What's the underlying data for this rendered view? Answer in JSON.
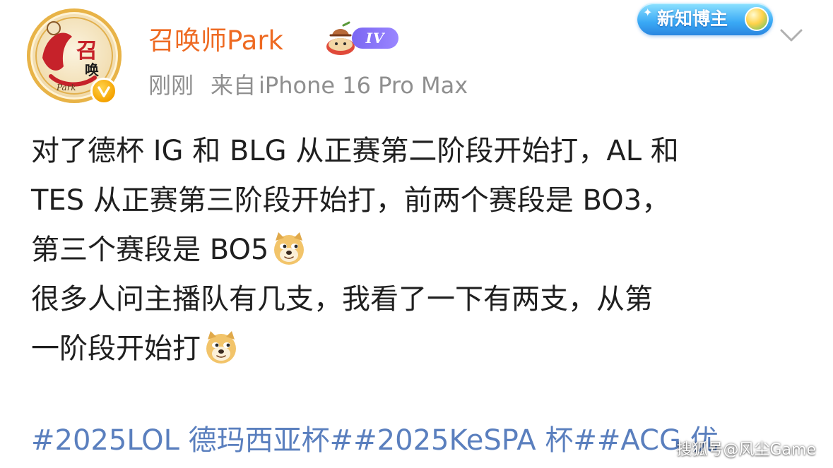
{
  "header": {
    "username": "召唤师Park",
    "level_badge": "IV",
    "hot_badge": "新知博主",
    "meta": {
      "time": "刚刚",
      "source_prefix": "来自",
      "device": "iPhone 16 Pro Max"
    }
  },
  "avatar": {
    "logo_text_1": "召",
    "logo_text_2": "唤",
    "logo_text_3": "Park"
  },
  "post": {
    "lines": [
      "对了德杯 IG 和 BLG 从正赛第二阶段开始打，AL 和",
      "TES 从正赛第三阶段开始打，前两个赛段是 BO3，",
      "第三个赛段是 BO5",
      "很多人问主播队有几支，我看了一下有两支，从第",
      "一阶段开始打"
    ],
    "emojis": [
      "doge-emoji",
      "doge-emoji"
    ]
  },
  "hashtags": "#2025LOL 德玛西亚杯##2025KeSPA 杯##ACG 优",
  "watermark": "搜狐号@风尘Game",
  "colors": {
    "username": "#ee6a22",
    "meta": "#8f8f8f",
    "hashtag": "#5a7fbe",
    "level_badge": "#7a66f2",
    "verified": "#f5a300"
  }
}
